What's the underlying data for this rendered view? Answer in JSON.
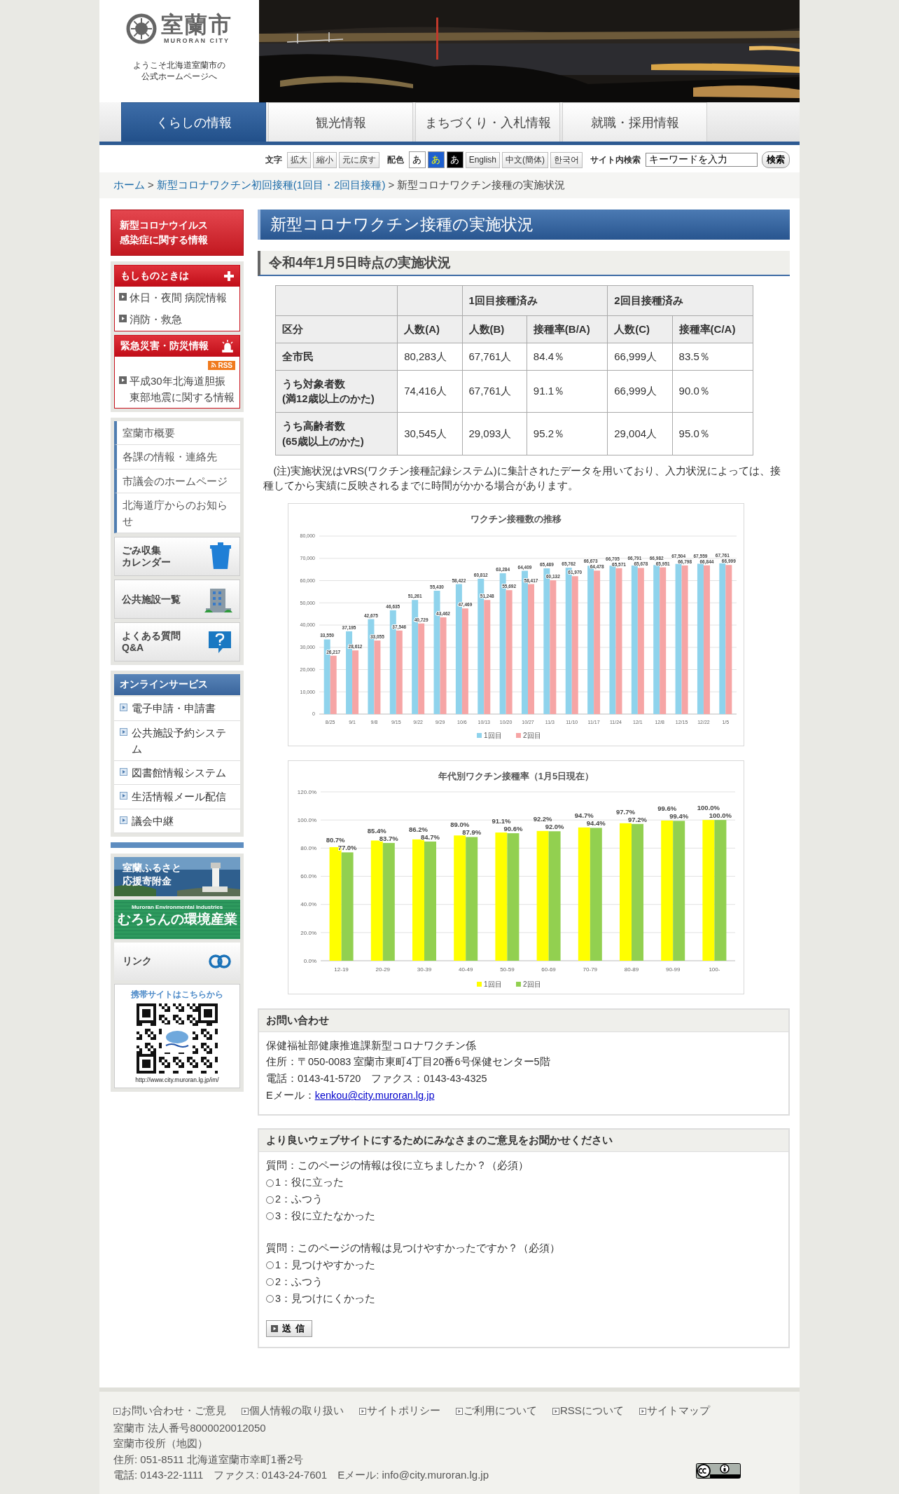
{
  "header": {
    "logo": {
      "name": "室蘭市",
      "roman": "MURORAN CITY",
      "welcome": "ようこそ北海道室蘭市の公式ホームページへ"
    }
  },
  "nav": {
    "tabs": [
      {
        "label": "くらしの情報",
        "selected": true
      },
      {
        "label": "観光情報",
        "selected": false
      },
      {
        "label": "まちづくり・入札情報",
        "selected": false
      },
      {
        "label": "就職・採用情報",
        "selected": false
      }
    ]
  },
  "toolbar": {
    "text_size": {
      "label": "文字",
      "buttons": [
        "拡大",
        "縮小",
        "元に戻す"
      ]
    },
    "color_scheme": {
      "label": "配色",
      "options": [
        {
          "label": "あ",
          "kind": "white"
        },
        {
          "label": "あ",
          "kind": "blue"
        },
        {
          "label": "あ",
          "kind": "black"
        }
      ]
    },
    "languages": [
      "English",
      "中文(簡体)",
      "한국어"
    ],
    "search": {
      "label": "サイト内検索",
      "value": "キーワードを入力",
      "button": "検索"
    }
  },
  "breadcrumb": [
    {
      "label": "ホーム",
      "kind": "link"
    },
    {
      "label": ">",
      "kind": "separator"
    },
    {
      "label": "新型コロナワクチン初回接種(1回目・2回目接種)",
      "kind": "link"
    },
    {
      "label": ">",
      "kind": "separator"
    },
    {
      "label": "新型コロナワクチン接種の実施状況",
      "kind": "current"
    }
  ],
  "sidebar": {
    "corona_button": "新型コロナウイルス感染症に関する情報",
    "alert_panels": [
      {
        "title": "もしものときは",
        "kind": "medical",
        "items": [
          "休日・夜間 病院情報",
          "消防・救急"
        ]
      },
      {
        "title": "緊急災害・防災情報",
        "kind": "disaster",
        "rss": "RSS",
        "items": [
          "平成30年北海道胆振東部地震に関する情報"
        ]
      }
    ],
    "links": [
      "室蘭市概要",
      "各課の情報・連絡先",
      "市議会のホームページ",
      "北海道庁からのお知らせ"
    ],
    "icon_buttons": [
      {
        "lines": [
          "ごみ収集",
          "カレンダー"
        ],
        "kind": "trash"
      },
      {
        "lines": [
          "公共施設一覧"
        ],
        "kind": "building"
      },
      {
        "lines": [
          "よくある質問",
          "Q&A"
        ],
        "kind": "faq"
      }
    ],
    "online": {
      "title": "オンラインサービス",
      "items": [
        "電子申請・申請書",
        "公共施設予約システム",
        "図書館情報システム",
        "生活情報メール配信",
        "議会中継"
      ]
    },
    "banners": [
      {
        "kind": "furusato",
        "text": "室蘭ふるさと応援寄附金"
      },
      {
        "kind": "environment",
        "caption": "Muroran Environmental Industries",
        "text": "むろらんの環境産業"
      },
      {
        "kind": "link",
        "text": "リンク"
      }
    ],
    "mobile": {
      "heading": "携帯サイトはこちらから",
      "url": "http://www.city.muroran.lg.jp/im/"
    }
  },
  "main": {
    "title": "新型コロナワクチン接種の実施状況",
    "subtitle": "令和4年1月5日時点の実施状況",
    "table": {
      "header_rows": [
        [
          "",
          "",
          {
            "label": "1回目接種済み",
            "colspan": 2
          },
          {
            "label": "2回目接種済み",
            "colspan": 2
          }
        ],
        [
          "区分",
          "人数(A)",
          "人数(B)",
          "接種率(B/A)",
          "人数(C)",
          "接種率(C/A)"
        ]
      ],
      "rows": [
        [
          "全市民",
          "80,283人",
          "67,761人",
          "84.4％",
          "66,999人",
          "83.5％"
        ],
        [
          "うち対象者数\n(満12歳以上のかた)",
          "74,416人",
          "67,761人",
          "91.1％",
          "66,999人",
          "90.0％"
        ],
        [
          "うち高齢者数\n(65歳以上のかた)",
          "30,545人",
          "29,093人",
          "95.2％",
          "29,004人",
          "95.0％"
        ]
      ]
    },
    "note": "(注)実施状況はVRS(ワクチン接種記録システム)に集計されたデータを用いており、入力状況によっては、接種してから実績に反映されるまでに時間がかかる場合があります。",
    "charts": [
      {
        "chart_data": {
          "type": "bar",
          "title": "ワクチン接種数の推移",
          "categories": [
            "8/25",
            "9/1",
            "9/8",
            "9/15",
            "9/22",
            "9/29",
            "10/6",
            "10/13",
            "10/20",
            "10/27",
            "11/3",
            "11/10",
            "11/17",
            "11/24",
            "12/1",
            "12/8",
            "12/15",
            "12/22",
            "1/5"
          ],
          "series": [
            {
              "name": "1回目",
              "color": "#8fd3ec",
              "values": [
                33550,
                37195,
                42675,
                46635,
                51261,
                55430,
                58422,
                60812,
                63284,
                64409,
                65489,
                65762,
                66673,
                66705,
                66791,
                66982,
                67504,
                67559,
                67761
              ],
              "value_labels": [
                "33,550",
                "37,195",
                "42,675",
                "46,635",
                "51,261",
                "55,430",
                "58,422",
                "60,812",
                "63,284",
                "64,409",
                "65,489",
                "65,762",
                "66,673",
                "66,705",
                "66,791",
                "66,982",
                "67,504",
                "67,559",
                "67,761"
              ]
            },
            {
              "name": "2回目",
              "color": "#f6a5a5",
              "values": [
                26217,
                28612,
                33055,
                37546,
                40729,
                43462,
                47469,
                51248,
                55692,
                58417,
                60132,
                61970,
                64478,
                65571,
                65678,
                65951,
                66798,
                66844,
                66999
              ],
              "value_labels": [
                "26,217",
                "28,612",
                "33,055",
                "37,546",
                "40,729",
                "43,462",
                "47,469",
                "51,248",
                "55,692",
                "58,417",
                "60,132",
                "61,970",
                "64,478",
                "65,571",
                "65,678",
                "65,951",
                "66,798",
                "66,844",
                "66,999"
              ]
            }
          ],
          "grid": true,
          "legend": "bottom",
          "ylim": [
            0,
            80000
          ],
          "yticks": [
            {
              "value": 0,
              "label": "0"
            },
            {
              "value": 10000,
              "label": "10,000"
            },
            {
              "value": 20000,
              "label": "20,000"
            },
            {
              "value": 30000,
              "label": "30,000"
            },
            {
              "value": 40000,
              "label": "40,000"
            },
            {
              "value": 50000,
              "label": "50,000"
            },
            {
              "value": 60000,
              "label": "60,000"
            },
            {
              "value": 70000,
              "label": "70,000"
            },
            {
              "value": 80000,
              "label": "80,000"
            }
          ],
          "data_labels": true
        }
      },
      {
        "chart_data": {
          "type": "bar",
          "title": "年代別ワクチン接種率（1月5日現在）",
          "categories": [
            "12-19",
            "20-29",
            "30-39",
            "40-49",
            "50-59",
            "60-69",
            "70-79",
            "80-89",
            "90-99",
            "100-"
          ],
          "series": [
            {
              "name": "1回目",
              "color": "#ffff00",
              "values": [
                80.7,
                85.4,
                86.2,
                89.0,
                91.1,
                92.2,
                94.7,
                97.7,
                99.6,
                100.0
              ],
              "value_labels": [
                "80.7%",
                "85.4%",
                "86.2%",
                "89.0%",
                "91.1%",
                "92.2%",
                "94.7%",
                "97.7%",
                "99.6%",
                "100.0%"
              ]
            },
            {
              "name": "2回目",
              "color": "#92d050",
              "values": [
                77.0,
                83.7,
                84.7,
                87.9,
                90.6,
                92.0,
                94.4,
                97.2,
                99.4,
                100.0
              ],
              "value_labels": [
                "77.0%",
                "83.7%",
                "84.7%",
                "87.9%",
                "90.6%",
                "92.0%",
                "94.4%",
                "97.2%",
                "99.4%",
                "100.0%"
              ]
            }
          ],
          "grid": true,
          "legend": "bottom",
          "ylim": [
            0,
            120
          ],
          "yticks": [
            {
              "value": 0,
              "label": "0.0%"
            },
            {
              "value": 20,
              "label": "20.0%"
            },
            {
              "value": 40,
              "label": "40.0%"
            },
            {
              "value": 60,
              "label": "60.0%"
            },
            {
              "value": 80,
              "label": "80.0%"
            },
            {
              "value": 100,
              "label": "100.0%"
            },
            {
              "value": 120,
              "label": "120.0%"
            }
          ],
          "data_labels": true
        }
      }
    ],
    "contact": {
      "title": "お問い合わせ",
      "lines": [
        "保健福祉部健康推進課新型コロナワクチン係",
        "住所：〒050-0083 室蘭市東町4丁目20番6号保健センター5階",
        "電話：0143-41-5720　ファクス：0143-43-4325"
      ],
      "email_label": "Eメール：",
      "email": "kenkou@city.muroran.lg.jp"
    },
    "survey": {
      "title": "より良いウェブサイトにするためにみなさまのご意見をお聞かせください",
      "questions": [
        {
          "text": "質問：このページの情報は役に立ちましたか？（必須）",
          "options": [
            {
              "label": "1：役に立った",
              "selected": false
            },
            {
              "label": "2：ふつう",
              "selected": false
            },
            {
              "label": "3：役に立たなかった",
              "selected": false
            }
          ]
        },
        {
          "text": "質問：このページの情報は見つけやすかったですか？（必須）",
          "options": [
            {
              "label": "1：見つけやすかった",
              "selected": false
            },
            {
              "label": "2：ふつう",
              "selected": false
            },
            {
              "label": "3：見つけにくかった",
              "selected": false
            }
          ]
        }
      ],
      "submit": "送信"
    }
  },
  "footer": {
    "links": [
      "お問い合わせ・ご意見",
      "個人情報の取り扱い",
      "サイトポリシー",
      "ご利用について",
      "RSSについて",
      "サイトマップ"
    ],
    "lines": [
      "室蘭市 法人番号8000020012050",
      "室蘭市役所（地図）",
      "住所: 051-8511 北海道室蘭市幸町1番2号",
      "電話: 0143-22-1111　ファクス: 0143-24-7601　Eメール: info@city.muroran.lg.jp"
    ]
  }
}
